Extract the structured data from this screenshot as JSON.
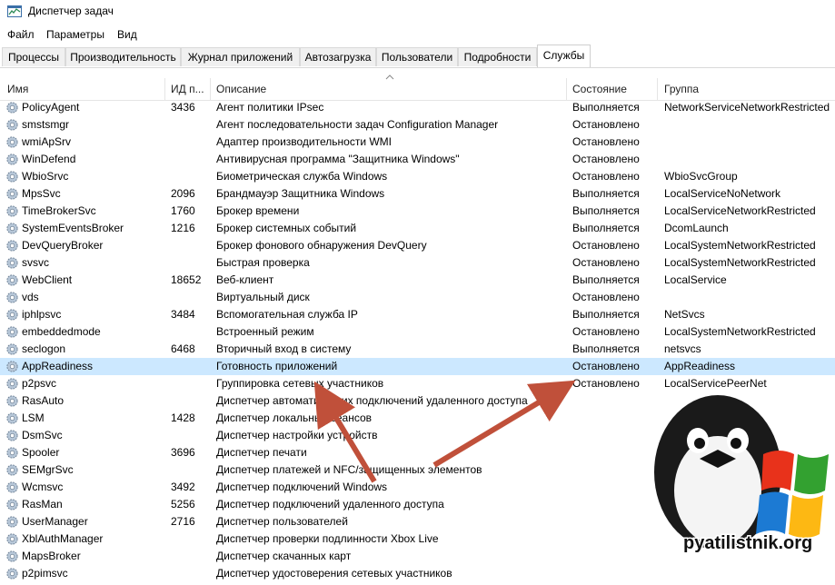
{
  "window": {
    "title": "Диспетчер задач"
  },
  "menu": [
    "Файл",
    "Параметры",
    "Вид"
  ],
  "tabs": [
    "Процессы",
    "Производительность",
    "Журнал приложений",
    "Автозагрузка",
    "Пользователи",
    "Подробности",
    "Службы"
  ],
  "active_tab": "Службы",
  "columns": {
    "name": "Имя",
    "pid": "ИД п...",
    "description": "Описание",
    "status": "Состояние",
    "group": "Группа"
  },
  "services": [
    {
      "name": "PolicyAgent",
      "pid": "3436",
      "description": "Агент политики IPsec",
      "status": "Выполняется",
      "group": "NetworkServiceNetworkRestricted"
    },
    {
      "name": "smstsmgr",
      "pid": "",
      "description": "Агент последовательности задач Configuration Manager",
      "status": "Остановлено",
      "group": ""
    },
    {
      "name": "wmiApSrv",
      "pid": "",
      "description": "Адаптер производительности WMI",
      "status": "Остановлено",
      "group": ""
    },
    {
      "name": "WinDefend",
      "pid": "",
      "description": "Антивирусная программа \"Защитника Windows\"",
      "status": "Остановлено",
      "group": ""
    },
    {
      "name": "WbioSrvc",
      "pid": "",
      "description": "Биометрическая служба Windows",
      "status": "Остановлено",
      "group": "WbioSvcGroup"
    },
    {
      "name": "MpsSvc",
      "pid": "2096",
      "description": "Брандмауэр Защитника Windows",
      "status": "Выполняется",
      "group": "LocalServiceNoNetwork"
    },
    {
      "name": "TimeBrokerSvc",
      "pid": "1760",
      "description": "Брокер времени",
      "status": "Выполняется",
      "group": "LocalServiceNetworkRestricted"
    },
    {
      "name": "SystemEventsBroker",
      "pid": "1216",
      "description": "Брокер системных событий",
      "status": "Выполняется",
      "group": "DcomLaunch"
    },
    {
      "name": "DevQueryBroker",
      "pid": "",
      "description": "Брокер фонового обнаружения DevQuery",
      "status": "Остановлено",
      "group": "LocalSystemNetworkRestricted"
    },
    {
      "name": "svsvc",
      "pid": "",
      "description": "Быстрая проверка",
      "status": "Остановлено",
      "group": "LocalSystemNetworkRestricted"
    },
    {
      "name": "WebClient",
      "pid": "18652",
      "description": "Веб-клиент",
      "status": "Выполняется",
      "group": "LocalService"
    },
    {
      "name": "vds",
      "pid": "",
      "description": "Виртуальный диск",
      "status": "Остановлено",
      "group": ""
    },
    {
      "name": "iphlpsvc",
      "pid": "3484",
      "description": "Вспомогательная служба IP",
      "status": "Выполняется",
      "group": "NetSvcs"
    },
    {
      "name": "embeddedmode",
      "pid": "",
      "description": "Встроенный режим",
      "status": "Остановлено",
      "group": "LocalSystemNetworkRestricted"
    },
    {
      "name": "seclogon",
      "pid": "6468",
      "description": "Вторичный вход в систему",
      "status": "Выполняется",
      "group": "netsvcs"
    },
    {
      "name": "AppReadiness",
      "pid": "",
      "description": "Готовность приложений",
      "status": "Остановлено",
      "group": "AppReadiness",
      "selected": true
    },
    {
      "name": "p2psvc",
      "pid": "",
      "description": "Группировка сетевых участников",
      "status": "Остановлено",
      "group": "LocalServicePeerNet"
    },
    {
      "name": "RasAuto",
      "pid": "",
      "description": "Диспетчер автоматических подключений удаленного доступа",
      "status": "",
      "group": ""
    },
    {
      "name": "LSM",
      "pid": "1428",
      "description": "Диспетчер локальных сеансов",
      "status": "",
      "group": ""
    },
    {
      "name": "DsmSvc",
      "pid": "",
      "description": "Диспетчер настройки устройств",
      "status": "",
      "group": ""
    },
    {
      "name": "Spooler",
      "pid": "3696",
      "description": "Диспетчер печати",
      "status": "",
      "group": ""
    },
    {
      "name": "SEMgrSvc",
      "pid": "",
      "description": "Диспетчер платежей и NFC/защищенных элементов",
      "status": "",
      "group": ""
    },
    {
      "name": "Wcmsvc",
      "pid": "3492",
      "description": "Диспетчер подключений Windows",
      "status": "",
      "group": ""
    },
    {
      "name": "RasMan",
      "pid": "5256",
      "description": "Диспетчер подключений удаленного доступа",
      "status": "",
      "group": ""
    },
    {
      "name": "UserManager",
      "pid": "2716",
      "description": "Диспетчер пользователей",
      "status": "",
      "group": ""
    },
    {
      "name": "XblAuthManager",
      "pid": "",
      "description": "Диспетчер проверки подлинности Xbox Live",
      "status": "",
      "group": ""
    },
    {
      "name": "MapsBroker",
      "pid": "",
      "description": "Диспетчер скачанных карт",
      "status": "",
      "group": ""
    },
    {
      "name": "p2pimsvc",
      "pid": "",
      "description": "Диспетчер удостоверения сетевых участников",
      "status": "",
      "group": ""
    }
  ],
  "watermark": {
    "text": "pyatilistnik.org"
  },
  "colors": {
    "selected_row": "#cce8ff",
    "annotation_arrow": "#c0503a"
  },
  "icons": {
    "title": "task-manager-icon",
    "service": "gear-icon",
    "sort": "sort-caret-icon"
  }
}
